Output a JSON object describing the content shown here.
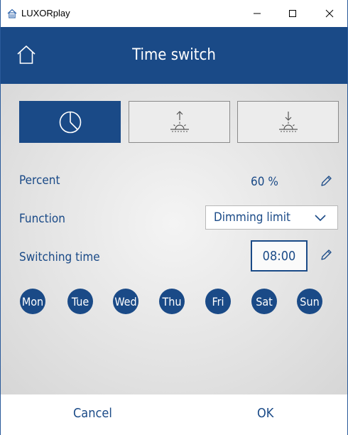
{
  "window": {
    "app_title": "LUXORplay"
  },
  "header": {
    "title": "Time switch"
  },
  "modes": [
    "timer",
    "sunrise",
    "sunset"
  ],
  "settings": {
    "percent_label": "Percent",
    "percent_value": "60 %",
    "function_label": "Function",
    "function_value": "Dimming limit",
    "switching_time_label": "Switching time",
    "switching_time_value": "08:00"
  },
  "days": [
    "Mon",
    "Tue",
    "Wed",
    "Thu",
    "Fri",
    "Sat",
    "Sun"
  ],
  "footer": {
    "cancel_label": "Cancel",
    "ok_label": "OK"
  },
  "colors": {
    "accent": "#1a4a87",
    "background": "#e4e4e4"
  }
}
